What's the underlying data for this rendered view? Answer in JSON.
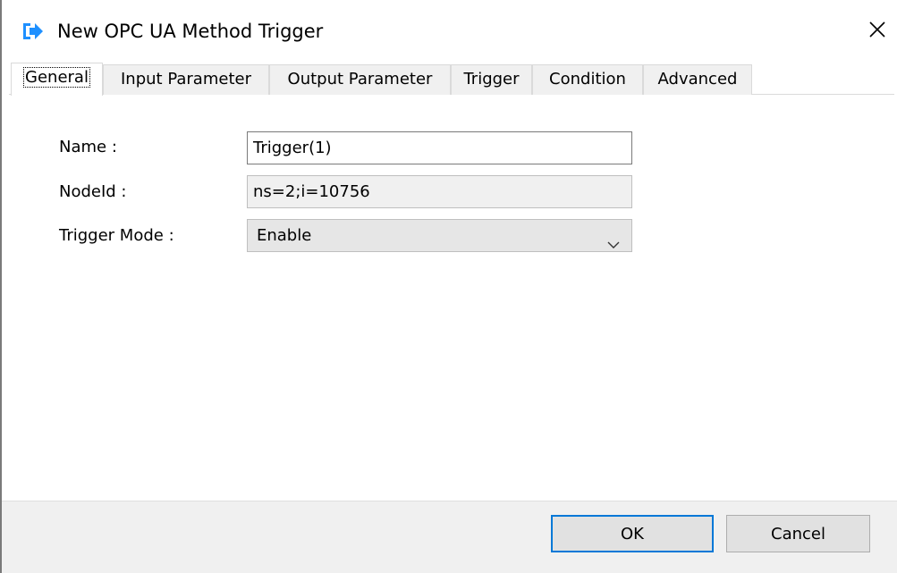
{
  "window": {
    "title": "New OPC UA Method Trigger",
    "close_label": "✕"
  },
  "tabs": [
    {
      "label": "General",
      "active": true
    },
    {
      "label": "Input Parameter",
      "active": false
    },
    {
      "label": "Output Parameter",
      "active": false
    },
    {
      "label": "Trigger",
      "active": false
    },
    {
      "label": "Condition",
      "active": false
    },
    {
      "label": "Advanced",
      "active": false
    }
  ],
  "form": {
    "name_label": "Name :",
    "name_value": "Trigger(1)",
    "nodeid_label": "NodeId :",
    "nodeid_value": "ns=2;i=10756",
    "trigger_mode_label": "Trigger Mode :",
    "trigger_mode_value": "Enable"
  },
  "buttons": {
    "ok_label": "OK",
    "cancel_label": "Cancel"
  },
  "icons": {
    "title_icon": "enter-arrow-icon",
    "close_icon": "close-icon",
    "dropdown_icon": "chevron-down-icon"
  },
  "colors": {
    "accent": "#0078d7",
    "title_icon": "#1e90ff"
  }
}
